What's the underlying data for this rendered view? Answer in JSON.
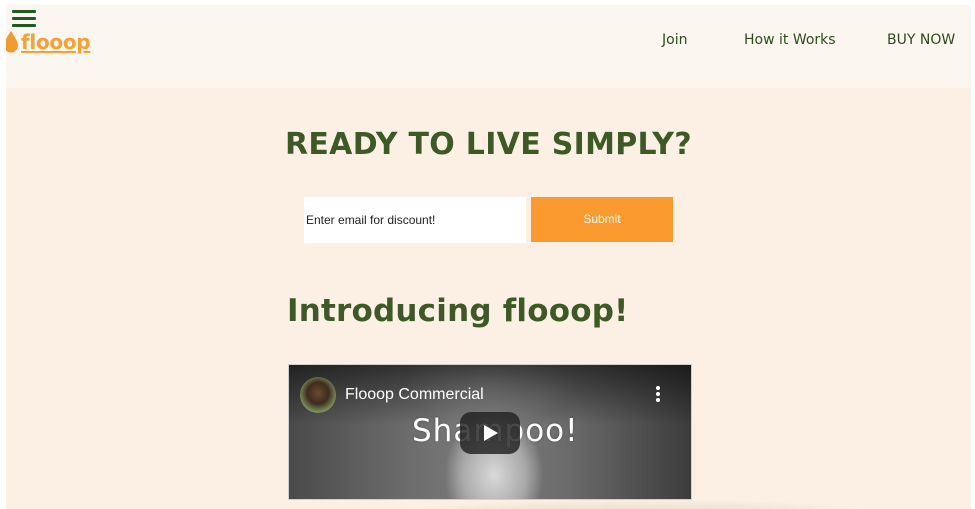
{
  "colors": {
    "page_background": "#fcf0e4",
    "header_background": "#fcf6f1",
    "accent_orange": "#fb9a2e",
    "heading_green": "#3d5a26",
    "menu_icon_green": "#1f5c1f"
  },
  "header": {
    "menu_icon": "hamburger-menu-icon",
    "logo": {
      "icon": "droplet-icon",
      "text": "flooop"
    },
    "nav": {
      "join": "Join",
      "how_it_works": "How it Works",
      "buy_now": "BUY NOW"
    }
  },
  "signup": {
    "heading": "READY TO LIVE SIMPLY?",
    "email_placeholder": "Enter email for discount!",
    "email_value": "",
    "submit_label": "Submit"
  },
  "intro": {
    "heading": "Introducing flooop!"
  },
  "video": {
    "title": "Flooop Commercial",
    "overlay_text": "Shampoo!",
    "channel_avatar": "channel-avatar",
    "menu_icon": "more-vertical-icon",
    "play_icon": "play-icon"
  }
}
